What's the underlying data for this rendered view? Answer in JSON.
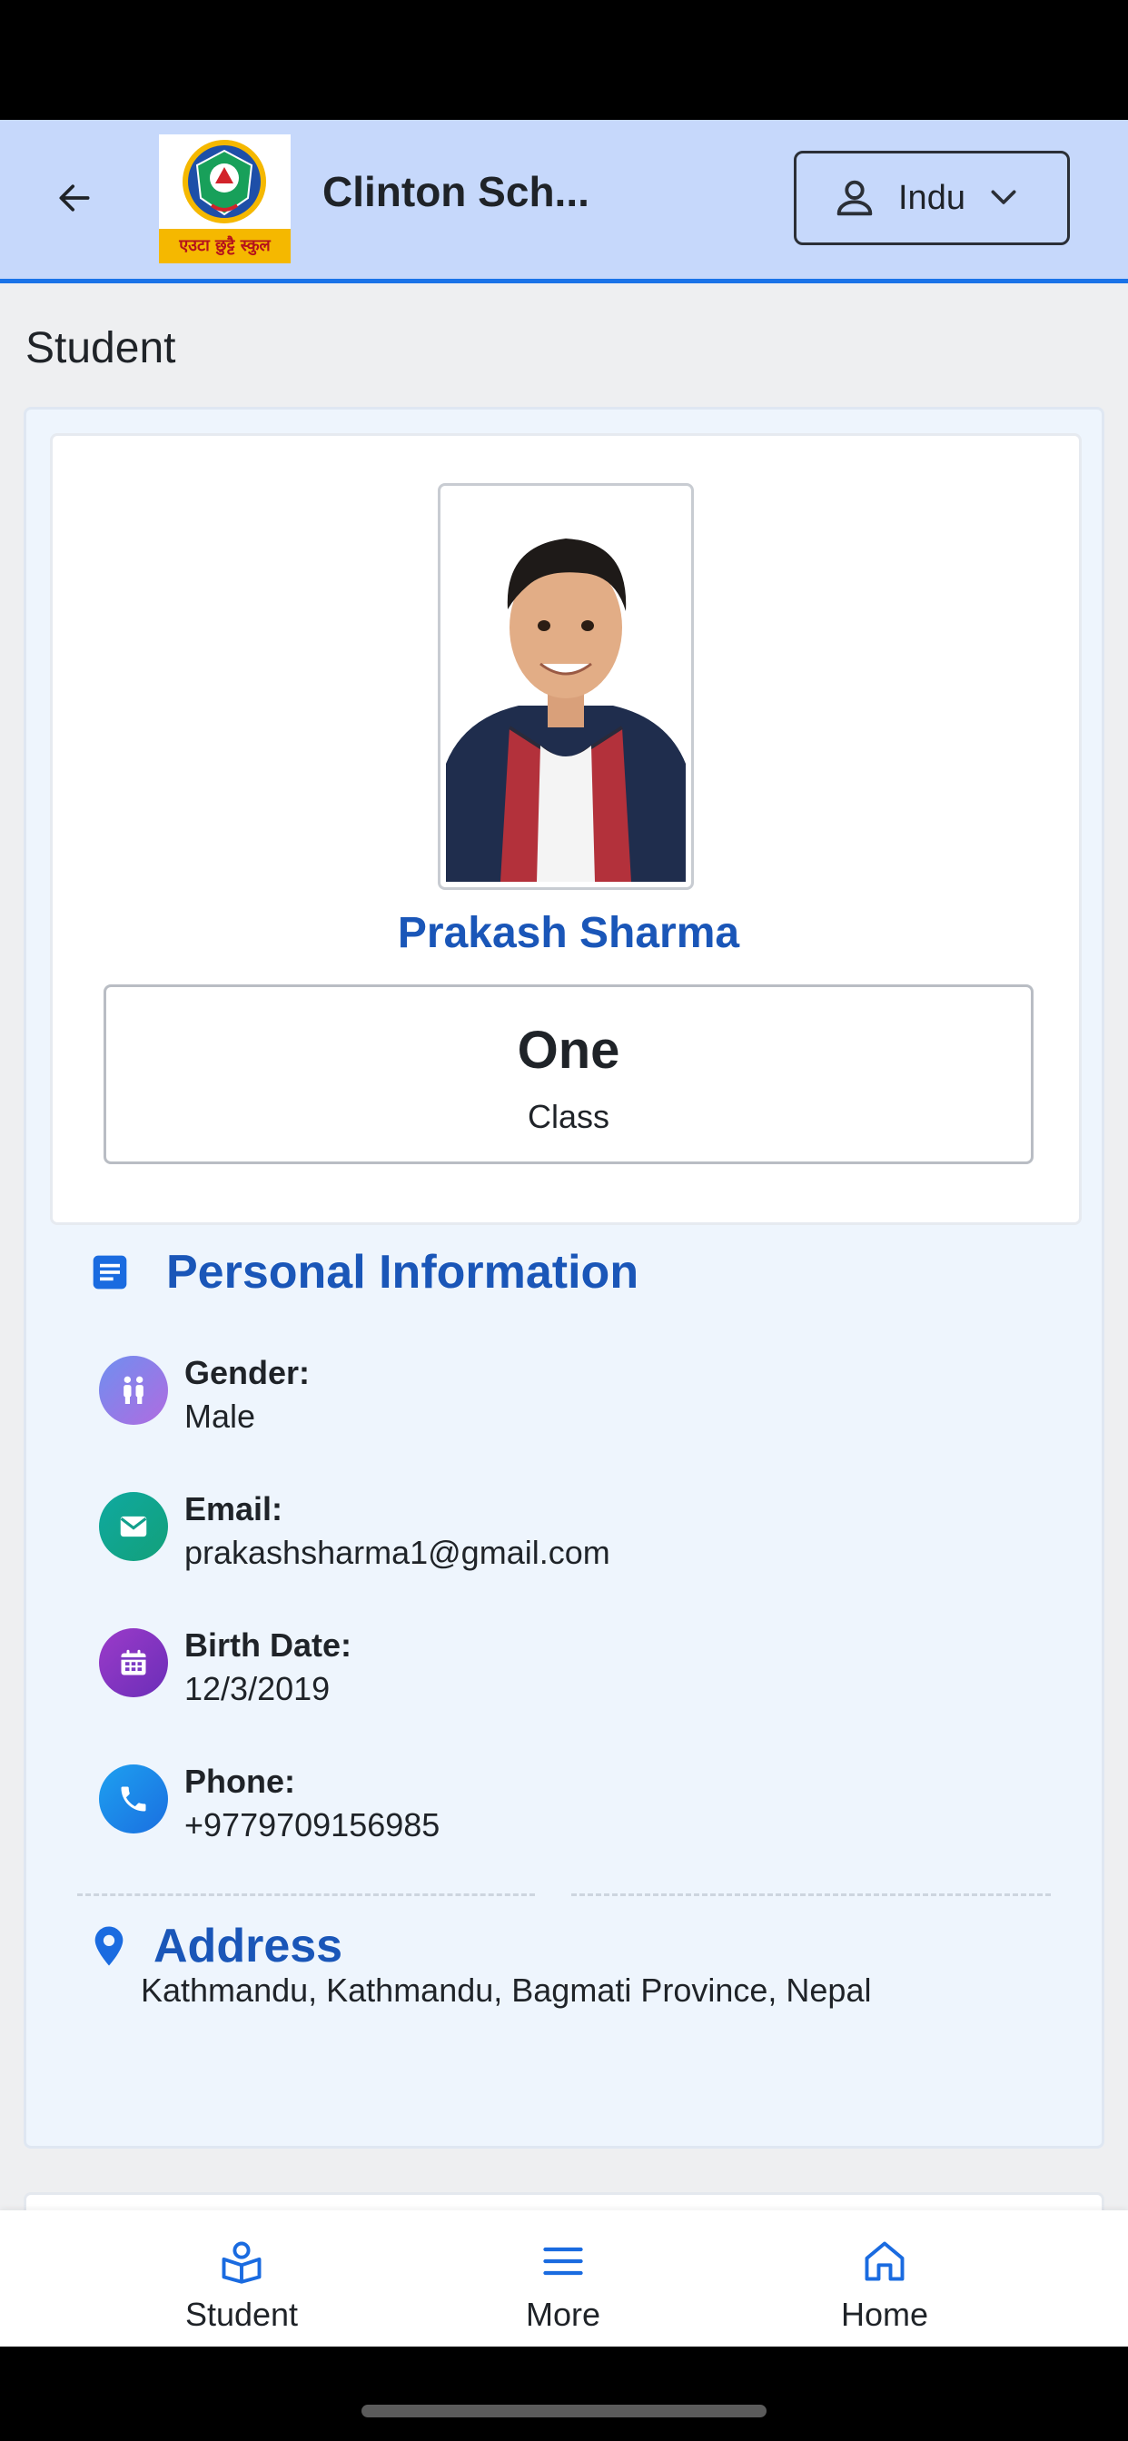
{
  "app_bar": {
    "school_name": "Clinton Sch...",
    "logo_text": "एउटा छुट्टै स्कुल",
    "user_name": "Indu"
  },
  "page": {
    "title": "Student"
  },
  "profile": {
    "name": "Prakash Sharma",
    "class_value": "One",
    "class_label": "Class"
  },
  "personal_info": {
    "title": "Personal Information",
    "fields": [
      {
        "label": "Gender:",
        "value": "Male",
        "icon": "gender-icon",
        "color": "#8f7be6"
      },
      {
        "label": "Email:",
        "value": "prakashsharma1@gmail.com",
        "icon": "mail-icon",
        "color": "#16a394"
      },
      {
        "label": "Birth Date:",
        "value": "12/3/2019",
        "icon": "calendar-icon",
        "color": "#7b3bc4"
      },
      {
        "label": "Phone:",
        "value": "+9779709156985",
        "icon": "phone-icon",
        "color": "#1f8ae6"
      }
    ]
  },
  "address": {
    "title": "Address",
    "value": "Kathmandu, Kathmandu, Bagmati Province, Nepal"
  },
  "bottom_nav": [
    {
      "label": "Student",
      "icon": "student-icon"
    },
    {
      "label": "More",
      "icon": "menu-icon"
    },
    {
      "label": "Home",
      "icon": "home-icon"
    }
  ],
  "colors": {
    "accent": "#1a56b8",
    "app_bar_bg": "#c6d8fb",
    "app_bar_border": "#1a73e8"
  }
}
